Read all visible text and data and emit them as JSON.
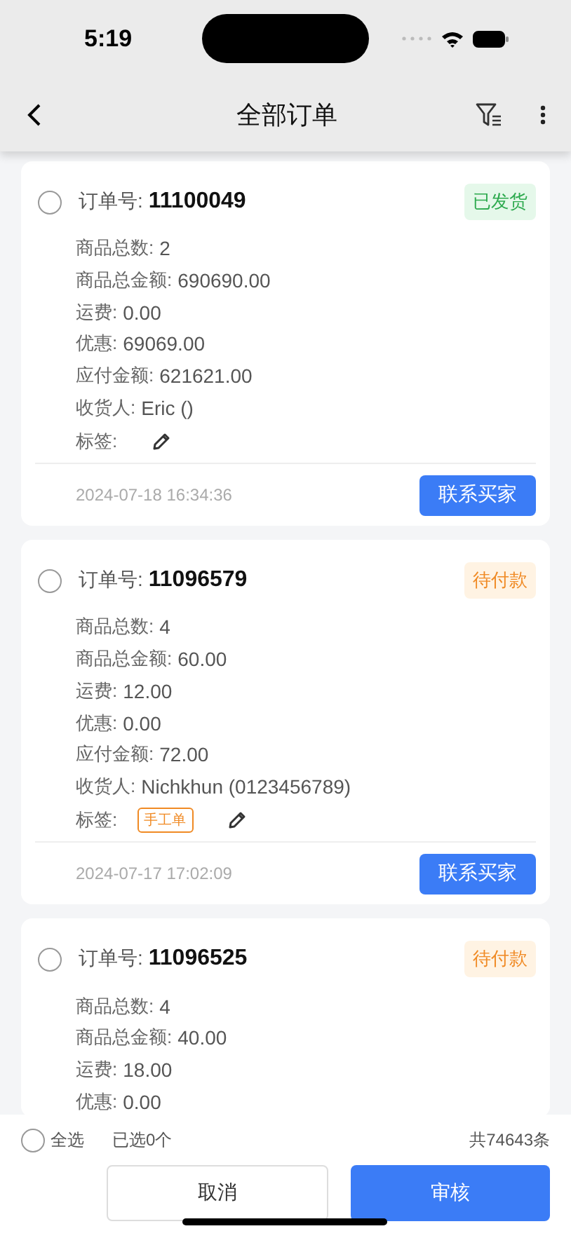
{
  "status_bar": {
    "time": "5:19"
  },
  "nav": {
    "title": "全部订单"
  },
  "orders": [
    {
      "selected": false,
      "order_label": "订单号:",
      "order_no": "11100049",
      "status": {
        "text": "已发货",
        "kind": "shipped"
      },
      "fields": [
        {
          "label": "商品总数:",
          "value": "2"
        },
        {
          "label": "商品总金额:",
          "value": "690690.00"
        },
        {
          "label": "运费:",
          "value": "0.00"
        },
        {
          "label": "优惠:",
          "value": "69069.00"
        },
        {
          "label": "应付金额:",
          "value": "621621.00"
        },
        {
          "label": "收货人:",
          "value": "Eric ()"
        }
      ],
      "tags_label": "标签:",
      "time": "2024-07-18 16:34:36",
      "action": "联系买家"
    },
    {
      "selected": false,
      "order_label": "订单号:",
      "order_no": "11096579",
      "status": {
        "text": "待付款",
        "kind": "pending"
      },
      "fields": [
        {
          "label": "商品总数:",
          "value": "4"
        },
        {
          "label": "商品总金额:",
          "value": "60.00"
        },
        {
          "label": "运费:",
          "value": "12.00"
        },
        {
          "label": "优惠:",
          "value": "0.00"
        },
        {
          "label": "应付金额:",
          "value": "72.00"
        },
        {
          "label": "收货人:",
          "value": "Nichkhun (0123456789)"
        }
      ],
      "tags_label": "标签:",
      "tags": [
        "手工单"
      ],
      "time": "2024-07-17 17:02:09",
      "action": "联系买家"
    },
    {
      "selected": false,
      "order_label": "订单号:",
      "order_no": "11096525",
      "status": {
        "text": "待付款",
        "kind": "pending"
      },
      "fields": [
        {
          "label": "商品总数:",
          "value": "4"
        },
        {
          "label": "商品总金额:",
          "value": "40.00"
        },
        {
          "label": "运费:",
          "value": "18.00"
        },
        {
          "label": "优惠:",
          "value": "0.00"
        }
      ]
    }
  ],
  "footer": {
    "select_all": {
      "label": "全选",
      "selected": false
    },
    "selected_count": "已选0个",
    "total": "共74643条",
    "cancel": "取消",
    "confirm": "审核"
  }
}
